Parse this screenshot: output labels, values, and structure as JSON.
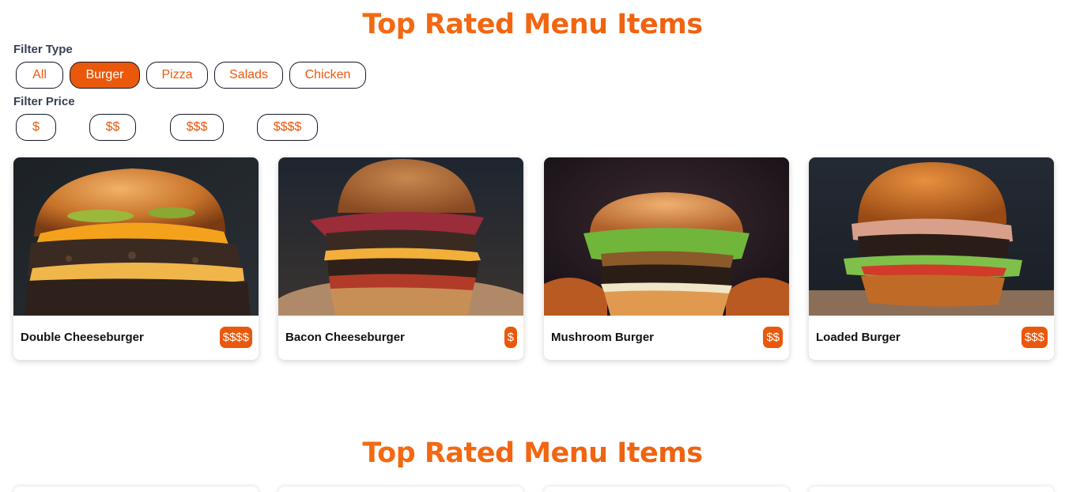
{
  "section_title": "Top Rated Menu Items",
  "filter_type": {
    "label": "Filter Type",
    "options": [
      "All",
      "Burger",
      "Pizza",
      "Salads",
      "Chicken"
    ],
    "selected": "Burger"
  },
  "filter_price": {
    "label": "Filter Price",
    "options": [
      "$",
      "$$",
      "$$$",
      "$$$$"
    ]
  },
  "items": [
    {
      "name": "Double Cheeseburger",
      "price": "$$$$",
      "image": "double-cheeseburger-photo"
    },
    {
      "name": "Bacon Cheeseburger",
      "price": "$",
      "image": "bacon-cheeseburger-photo"
    },
    {
      "name": "Mushroom Burger",
      "price": "$$",
      "image": "mushroom-burger-photo"
    },
    {
      "name": "Loaded Burger",
      "price": "$$$",
      "image": "loaded-burger-photo"
    }
  ],
  "colors": {
    "accent": "#ea580c",
    "accent_light": "#f97316",
    "text_dark": "#111111",
    "label": "#374151"
  }
}
